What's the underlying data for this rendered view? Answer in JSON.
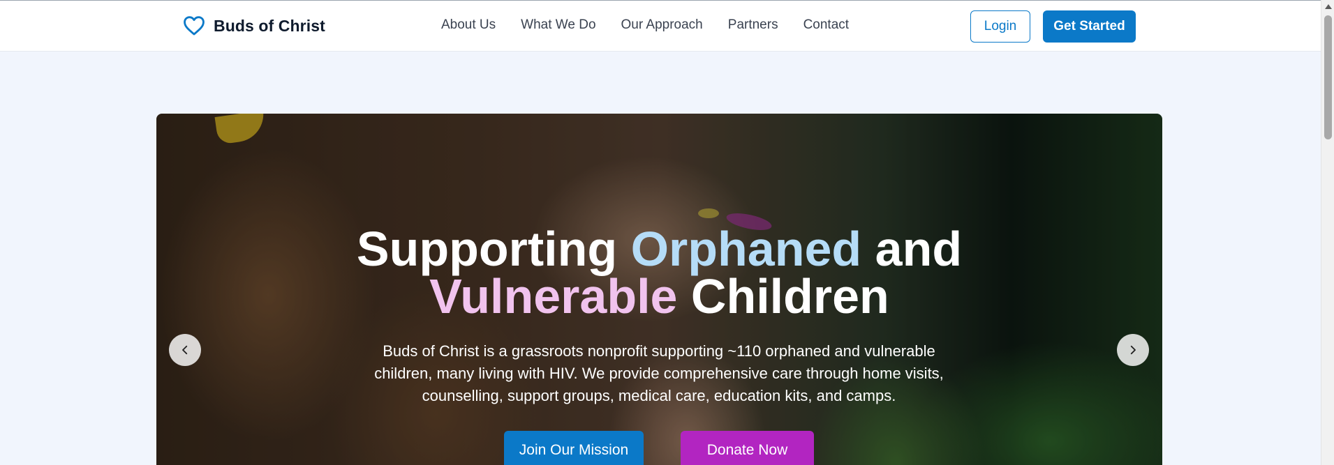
{
  "brand": {
    "name": "Buds of Christ",
    "logo_icon": "heart-outline-icon",
    "accent": "#0b79c8"
  },
  "nav": {
    "items": [
      {
        "label": "About Us"
      },
      {
        "label": "What We Do"
      },
      {
        "label": "Our Approach"
      },
      {
        "label": "Partners"
      },
      {
        "label": "Contact"
      }
    ]
  },
  "header": {
    "login_label": "Login",
    "get_started_label": "Get Started"
  },
  "hero": {
    "title_part1": "Supporting ",
    "title_highlight1": "Orphaned",
    "title_part2": " and",
    "title_highlight2": "Vulnerable",
    "title_part3": " Children",
    "description": "Buds of Christ is a grassroots nonprofit supporting ~110 orphaned and vulnerable children, many living with HIV. We provide comprehensive care through home visits, counselling, support groups, medical care, education kits, and camps.",
    "join_label": "Join Our Mission",
    "donate_label": "Donate Now",
    "prev_icon": "chevron-left-icon",
    "next_icon": "chevron-right-icon",
    "highlight_colors": {
      "orphaned": "#b5dcf7",
      "vulnerable": "#f1c3ee"
    },
    "donate_color": "#b225c1"
  }
}
